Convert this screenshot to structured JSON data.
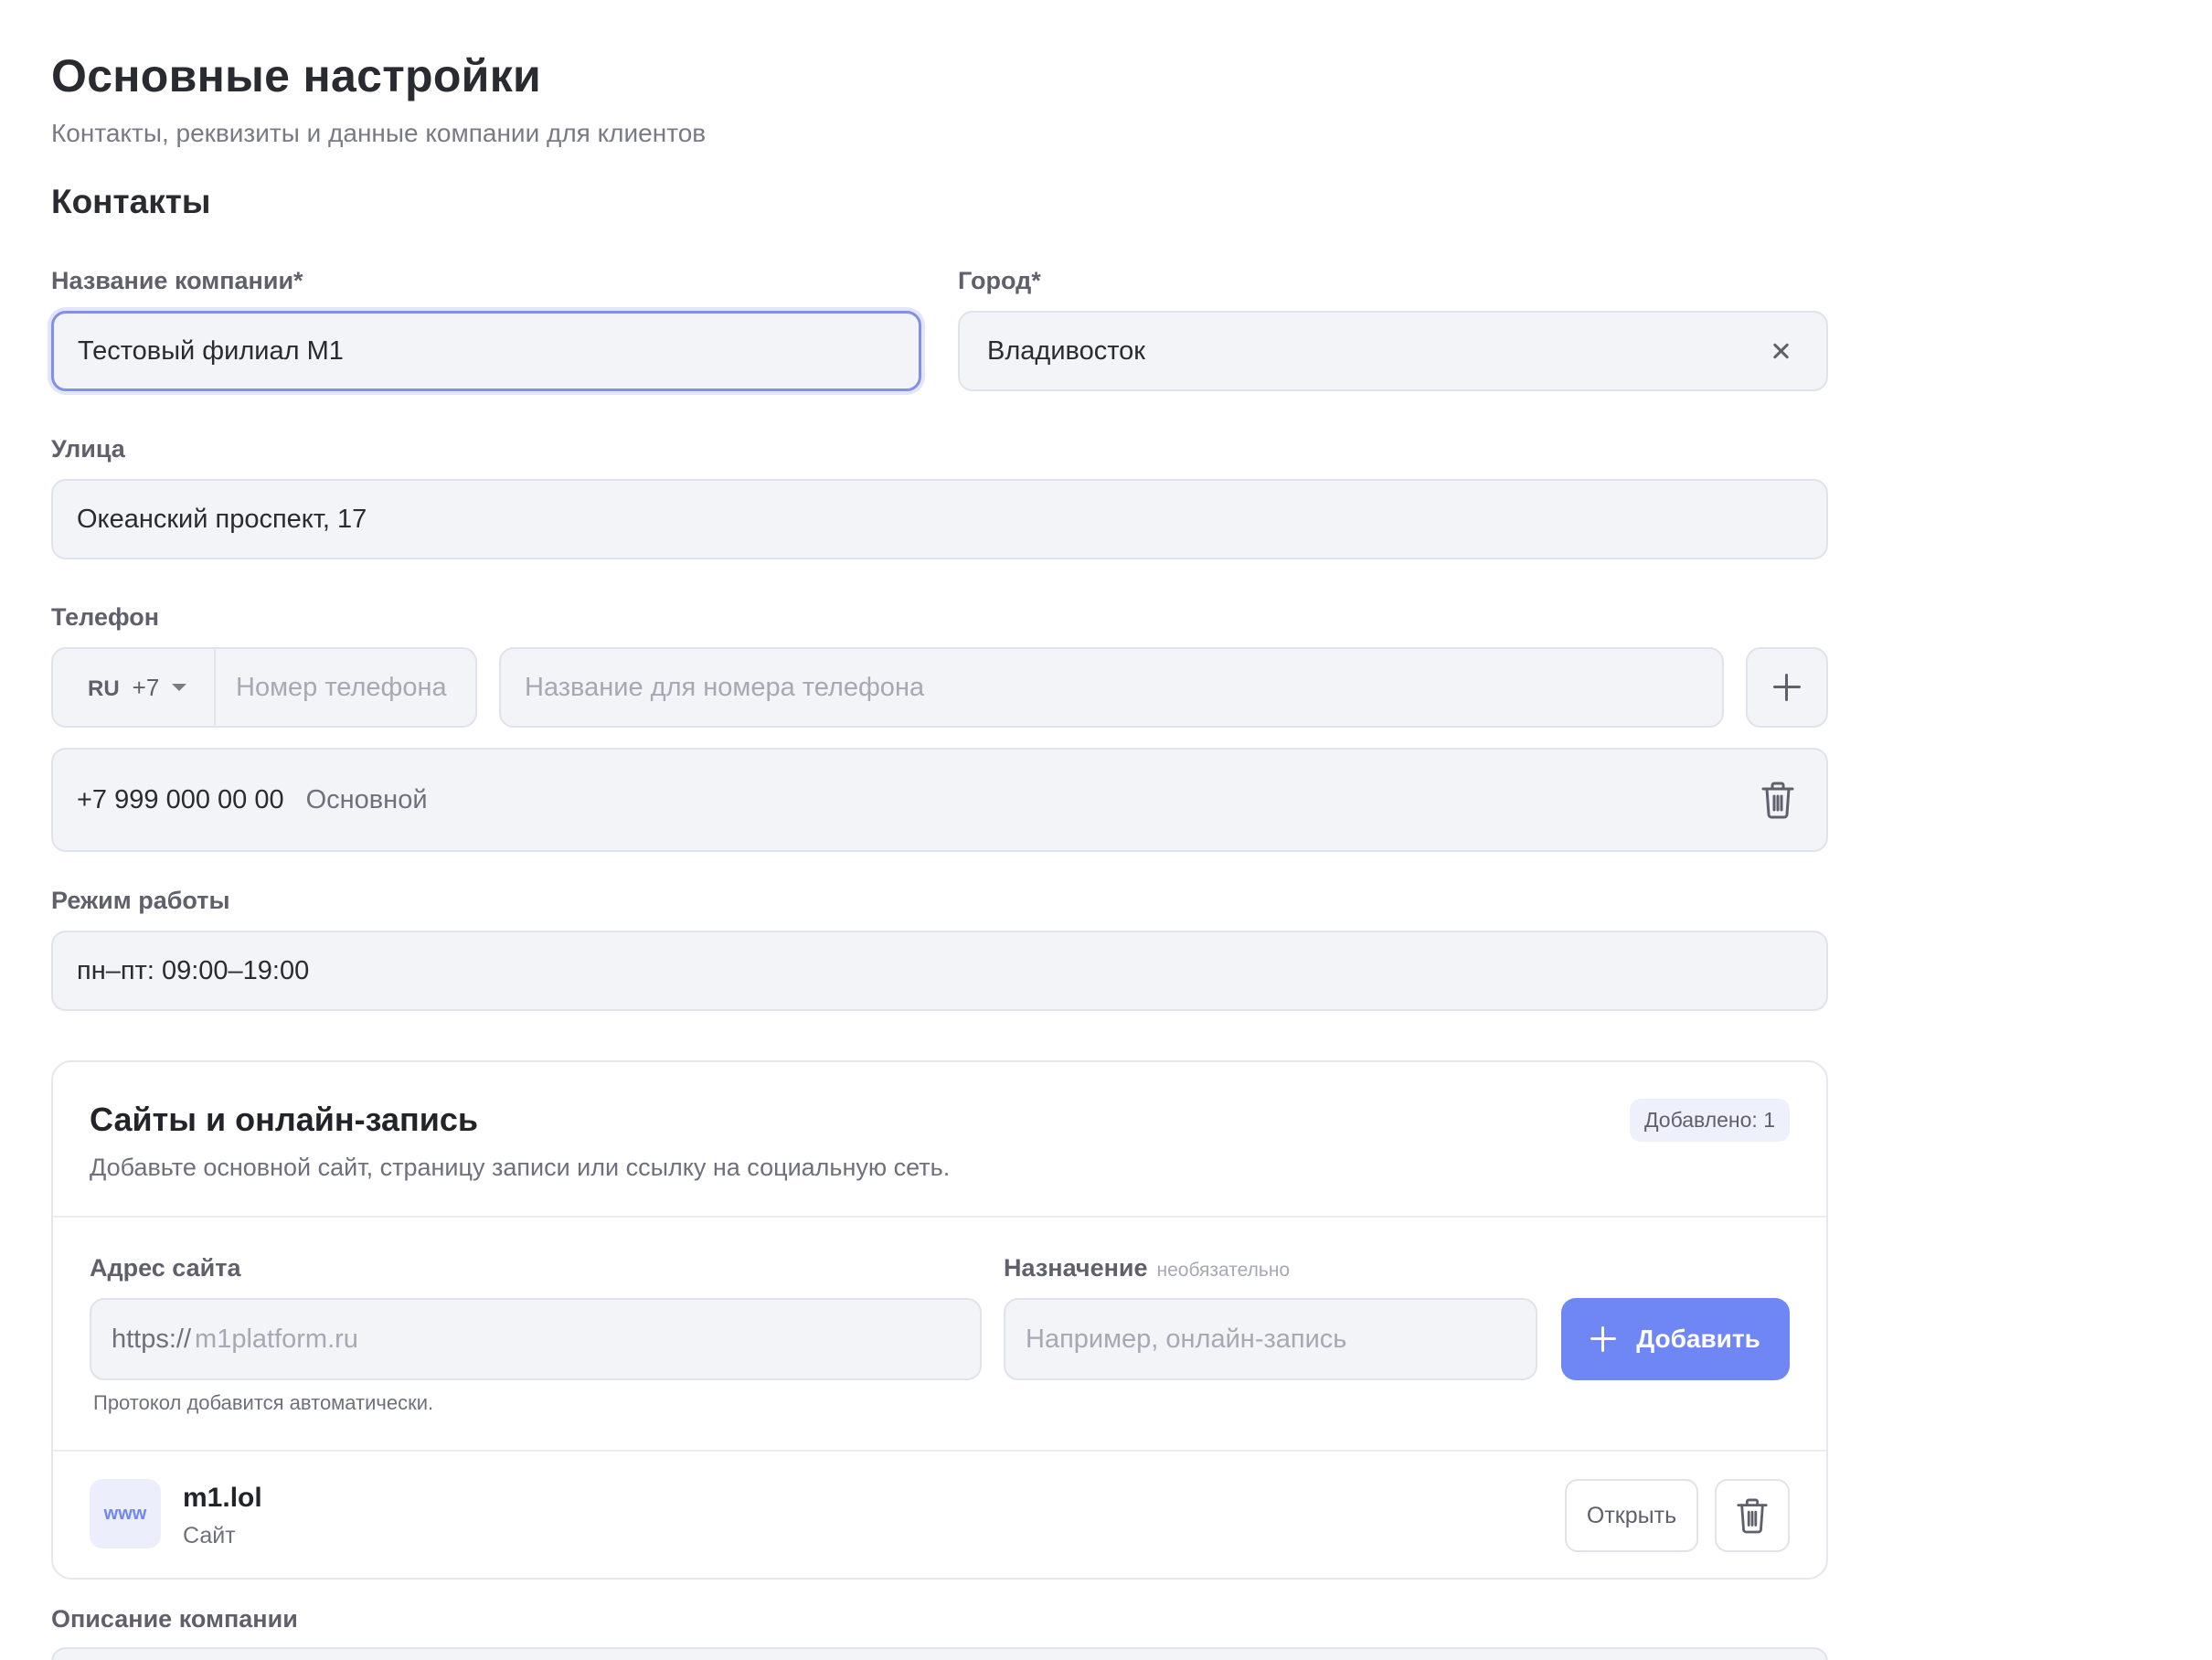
{
  "header": {
    "title": "Основные настройки",
    "subtitle": "Контакты, реквизиты и данные компании для клиентов"
  },
  "contacts": {
    "heading": "Контакты",
    "company_label": "Название компании*",
    "company_value": "Тестовый филиал М1",
    "city_label": "Город*",
    "city_value": "Владивосток",
    "street_label": "Улица",
    "street_value": "Океанский проспект, 17",
    "phone_label": "Телефон",
    "country_code": "RU",
    "dial_code": "+7",
    "phone_placeholder": "Номер телефона",
    "phone_name_placeholder": "Название для номера телефона",
    "phones": [
      {
        "number": "+7 999 000 00 00",
        "name": "Основной"
      }
    ],
    "hours_label": "Режим работы",
    "hours_value": "пн–пт: 09:00–19:00"
  },
  "sites": {
    "title": "Сайты и онлайн-запись",
    "subtitle": "Добавьте основной сайт, страницу записи или ссылку на социальную сеть.",
    "badge": "Добавлено: 1",
    "address_label": "Адрес сайта",
    "address_prefix": "https://",
    "address_placeholder": "m1platform.ru",
    "purpose_label": "Назначение",
    "purpose_optional": "необязательно",
    "purpose_placeholder": "Например, онлайн-запись",
    "add_label": "Добавить",
    "hint": "Протокол добавится автоматически.",
    "items": [
      {
        "icon_text": "www",
        "name": "m1.lol",
        "type": "Сайт",
        "open_label": "Открыть"
      }
    ]
  },
  "description": {
    "label": "Описание компании"
  },
  "colors": {
    "accent": "#6f86f5",
    "focus_border": "#8390e6",
    "field_bg": "#f3f4f8"
  },
  "icons": {
    "clear": "close-icon",
    "add_phone": "plus-icon",
    "delete": "trash-icon",
    "dropdown": "chevron-down-icon"
  }
}
